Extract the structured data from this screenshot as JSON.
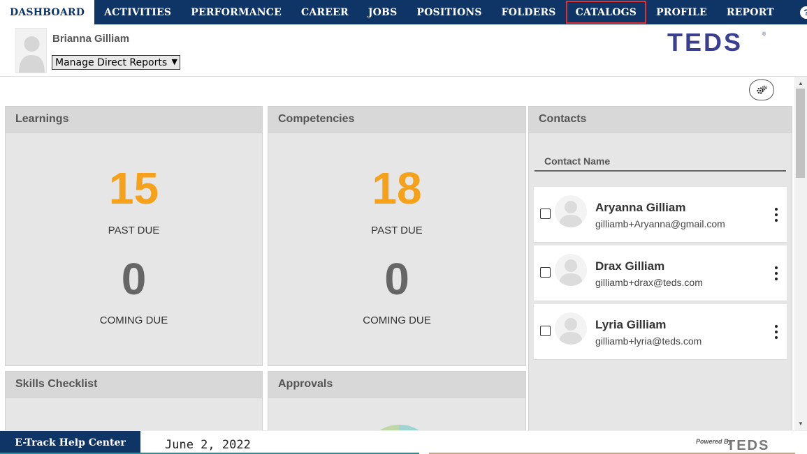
{
  "nav": {
    "items": [
      {
        "label": "DASHBOARD",
        "active": true
      },
      {
        "label": "ACTIVITIES"
      },
      {
        "label": "PERFORMANCE"
      },
      {
        "label": "CAREER"
      },
      {
        "label": "JOBS"
      },
      {
        "label": "POSITIONS"
      },
      {
        "label": "FOLDERS"
      },
      {
        "label": "CATALOGS",
        "highlighted": true
      },
      {
        "label": "PROFILE"
      },
      {
        "label": "REPORT"
      }
    ],
    "help_icon": "question-circle-icon"
  },
  "user": {
    "name": "Brianna Gilliam",
    "select_value": "Manage Direct Reports",
    "avatar_icon": "person-silhouette-icon"
  },
  "brand": {
    "logo_text": "TEDS",
    "color": "#3a3f8f"
  },
  "toolbar": {
    "gear_icon": "gears-icon"
  },
  "learnings": {
    "title": "Learnings",
    "past_due_count": "15",
    "past_due_label": "PAST DUE",
    "coming_due_count": "0",
    "coming_due_label": "COMING DUE"
  },
  "competencies": {
    "title": "Competencies",
    "past_due_count": "18",
    "past_due_label": "PAST DUE",
    "coming_due_count": "0",
    "coming_due_label": "COMING DUE"
  },
  "contacts": {
    "title": "Contacts",
    "column_header": "Contact Name",
    "items": [
      {
        "name": "Aryanna Gilliam",
        "email": "gilliamb+Aryanna@gmail.com"
      },
      {
        "name": "Drax Gilliam",
        "email": "gilliamb+drax@teds.com"
      },
      {
        "name": "Lyria Gilliam",
        "email": "gilliamb+lyria@teds.com"
      }
    ]
  },
  "skills": {
    "title": "Skills Checklist"
  },
  "approvals": {
    "title": "Approvals"
  },
  "footer": {
    "help_center": "E-Track Help Center",
    "date": "June 2, 2022",
    "powered_by": "Powered By",
    "powered_logo": "TEDS"
  },
  "colors": {
    "nav_bg": "#0e3566",
    "accent_orange": "#f5a21a",
    "highlight_red": "#e03030"
  }
}
